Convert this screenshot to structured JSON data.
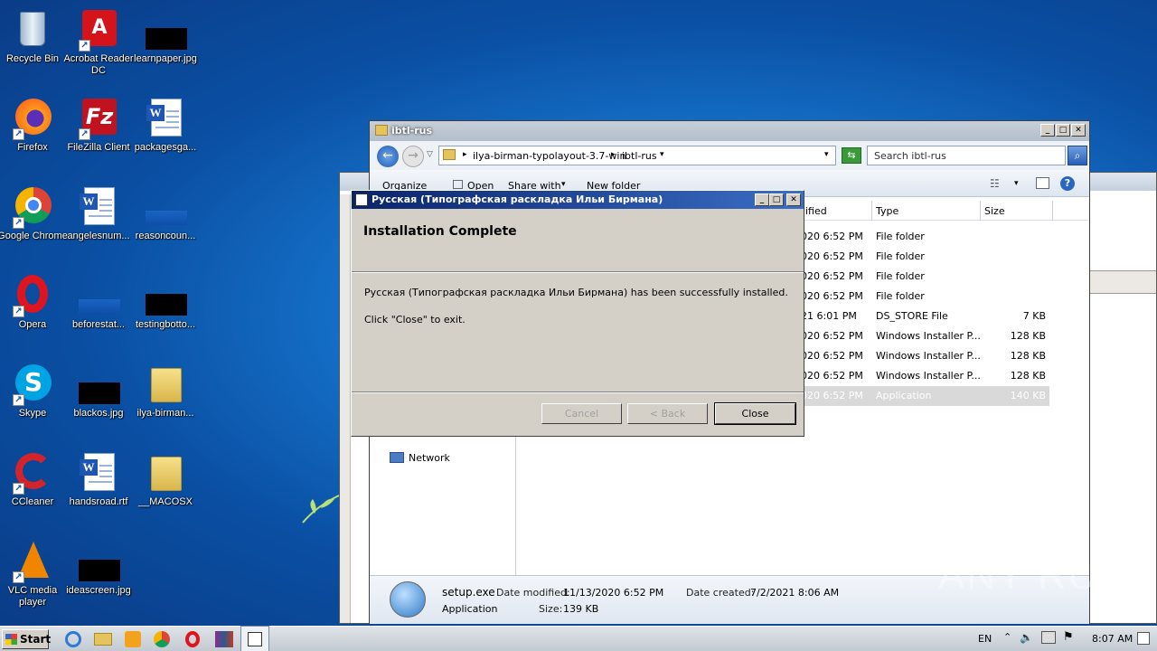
{
  "desktop": {
    "icons": [
      {
        "label": "Recycle Bin",
        "icon": "recycle-bin-icon"
      },
      {
        "label": "Acrobat Reader DC",
        "icon": "acrobat-icon"
      },
      {
        "label": "learnpaper.jpg",
        "icon": "image-file-icon"
      },
      {
        "label": "Firefox",
        "icon": "firefox-icon"
      },
      {
        "label": "FileZilla Client",
        "icon": "filezilla-icon"
      },
      {
        "label": "packagesga...",
        "icon": "word-doc-icon"
      },
      {
        "label": "Google Chrome",
        "icon": "chrome-icon"
      },
      {
        "label": "angelesnum...",
        "icon": "word-doc-icon"
      },
      {
        "label": "reasoncoun...",
        "icon": "file-icon"
      },
      {
        "label": "Opera",
        "icon": "opera-icon"
      },
      {
        "label": "beforestat...",
        "icon": "file-icon"
      },
      {
        "label": "testingbotto...",
        "icon": "image-file-icon"
      },
      {
        "label": "Skype",
        "icon": "skype-icon"
      },
      {
        "label": "blackos.jpg",
        "icon": "image-file-icon"
      },
      {
        "label": "ilya-birman...",
        "icon": "folder-icon"
      },
      {
        "label": "CCleaner",
        "icon": "ccleaner-icon"
      },
      {
        "label": "handsroad.rtf",
        "icon": "word-doc-icon"
      },
      {
        "label": "__MACOSX",
        "icon": "folder-icon"
      },
      {
        "label": "VLC media player",
        "icon": "vlc-icon"
      },
      {
        "label": "ideascreen.jpg",
        "icon": "image-file-icon"
      }
    ]
  },
  "explorer": {
    "title": "ibtl-rus",
    "breadcrumb": [
      "ilya-birman-typolayout-3.7-win",
      "ibtl-rus"
    ],
    "search_placeholder": "Search ibtl-rus",
    "toolbar": {
      "organize": "Organize",
      "open": "Open",
      "share_with": "Share with",
      "new_folder": "New folder"
    },
    "columns": {
      "modified": "dified",
      "type": "Type",
      "size": "Size"
    },
    "rows": [
      {
        "date": "020 6:52 PM",
        "type": "File folder",
        "size": ""
      },
      {
        "date": "020 6:52 PM",
        "type": "File folder",
        "size": ""
      },
      {
        "date": "020 6:52 PM",
        "type": "File folder",
        "size": ""
      },
      {
        "date": "020 6:52 PM",
        "type": "File folder",
        "size": ""
      },
      {
        "date": "21 6:01 PM",
        "type": "DS_STORE File",
        "size": "7 KB"
      },
      {
        "date": "020 6:52 PM",
        "type": "Windows Installer P...",
        "size": "128 KB"
      },
      {
        "date": "020 6:52 PM",
        "type": "Windows Installer P...",
        "size": "128 KB"
      },
      {
        "date": "020 6:52 PM",
        "type": "Windows Installer P...",
        "size": "128 KB"
      },
      {
        "date": "020 6:52 PM",
        "type": "Application",
        "size": "140 KB"
      }
    ],
    "nav_network": "Network",
    "details": {
      "name": "setup.exe",
      "modified_label": "Date modified:",
      "modified_value": "11/13/2020 6:52 PM",
      "created_label": "Date created:",
      "created_value": "7/2/2021 8:06 AM",
      "kind": "Application",
      "size_label": "Size:",
      "size_value": "139 KB"
    }
  },
  "installer": {
    "title": "Русская (Типографская раскладка Ильи Бирмана)",
    "heading": "Installation Complete",
    "message": "Русская (Типографская раскладка Ильи Бирмана) has been successfully installed.",
    "instruction": "Click \"Close\" to exit.",
    "cancel_label": "Cancel",
    "back_label": "< Back",
    "close_label": "Close"
  },
  "taskbar": {
    "start_label": "Start",
    "language": "EN",
    "clock": "8:07 AM"
  },
  "watermark": "ANY RUN"
}
